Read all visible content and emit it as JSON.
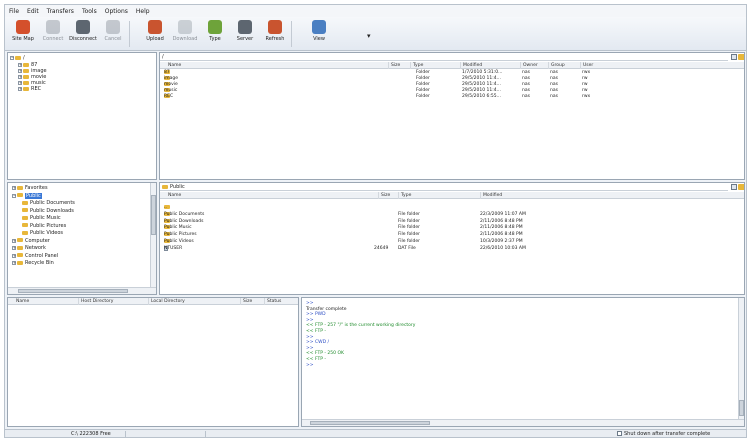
{
  "menu": [
    "File",
    "Edit",
    "Transfers",
    "Tools",
    "Options",
    "Help"
  ],
  "toolbar": [
    {
      "label": "Site Map",
      "icon": "site-map-icon",
      "color": "#d4502c",
      "enabled": true
    },
    {
      "label": "Connect",
      "icon": "connect-icon",
      "color": "#8a9199",
      "enabled": false
    },
    {
      "label": "Disconnect",
      "icon": "disconnect-icon",
      "color": "#5d6670",
      "enabled": true
    },
    {
      "label": "Cancel",
      "icon": "cancel-icon",
      "color": "#8a9199",
      "enabled": false
    },
    {
      "label": "Upload",
      "icon": "upload-icon",
      "color": "#c9542f",
      "enabled": true
    },
    {
      "label": "Download",
      "icon": "download-icon",
      "color": "#9aa1a8",
      "enabled": false
    },
    {
      "label": "Type",
      "icon": "type-icon",
      "color": "#6ea33a",
      "enabled": true
    },
    {
      "label": "Server",
      "icon": "server-icon",
      "color": "#5d6670",
      "enabled": true
    },
    {
      "label": "Refresh",
      "icon": "refresh-icon",
      "color": "#c9542f",
      "enabled": true
    },
    {
      "label": "View",
      "icon": "view-icon",
      "color": "#4a7fc2",
      "enabled": true
    }
  ],
  "remote": {
    "tree_root": "/",
    "tree": [
      "87",
      "image",
      "movie",
      "music",
      "REC"
    ],
    "path": "/",
    "columns": [
      "Name",
      "Size",
      "Type",
      "Modified",
      "Owner",
      "Group",
      "User"
    ],
    "files": [
      {
        "name": "87",
        "size": "",
        "type": "Folder",
        "modified": "1/7/2010 5:31:0...",
        "owner": "nas",
        "group": "nas",
        "user": "rwx"
      },
      {
        "name": "image",
        "size": "",
        "type": "Folder",
        "modified": "29/5/2010 11:4...",
        "owner": "nas",
        "group": "nas",
        "user": "rw"
      },
      {
        "name": "movie",
        "size": "",
        "type": "Folder",
        "modified": "29/5/2010 11:4...",
        "owner": "nas",
        "group": "nas",
        "user": "rw"
      },
      {
        "name": "music",
        "size": "",
        "type": "Folder",
        "modified": "29/5/2010 11:4...",
        "owner": "nas",
        "group": "nas",
        "user": "rw"
      },
      {
        "name": "REC",
        "size": "",
        "type": "Folder",
        "modified": "29/5/2010 6:55...",
        "owner": "nas",
        "group": "nas",
        "user": "rwx"
      }
    ]
  },
  "local": {
    "tree": [
      {
        "label": "Favorites",
        "indent": 0
      },
      {
        "label": "Public",
        "indent": 0,
        "selected": true
      },
      {
        "label": "Public Documents",
        "indent": 1
      },
      {
        "label": "Public Downloads",
        "indent": 1
      },
      {
        "label": "Public Music",
        "indent": 1
      },
      {
        "label": "Public Pictures",
        "indent": 1
      },
      {
        "label": "Public Videos",
        "indent": 1
      },
      {
        "label": "Computer",
        "indent": 0
      },
      {
        "label": "Network",
        "indent": 0
      },
      {
        "label": "Control Panel",
        "indent": 0
      },
      {
        "label": "Recycle Bin",
        "indent": 0
      }
    ],
    "path": "Public",
    "columns": [
      "Name",
      "Size",
      "Type",
      "Modified"
    ],
    "files": [
      {
        "name": "..",
        "size": "",
        "type": "",
        "modified": "",
        "kind": "folder"
      },
      {
        "name": "Public Documents",
        "size": "",
        "type": "File folder",
        "modified": "22/3/2009 11:07 AM",
        "kind": "folder"
      },
      {
        "name": "Public Downloads",
        "size": "",
        "type": "File folder",
        "modified": "2/11/2006 8:48 PM",
        "kind": "folder"
      },
      {
        "name": "Public Music",
        "size": "",
        "type": "File folder",
        "modified": "2/11/2006 8:48 PM",
        "kind": "folder"
      },
      {
        "name": "Public Pictures",
        "size": "",
        "type": "File folder",
        "modified": "2/11/2006 8:48 PM",
        "kind": "folder"
      },
      {
        "name": "Public Videos",
        "size": "",
        "type": "File folder",
        "modified": "10/3/2009 2:37 PM",
        "kind": "folder"
      },
      {
        "name": "NTUSER",
        "size": "24649",
        "type": "DAT File",
        "modified": "22/6/2010 10:03 AM",
        "kind": "file"
      }
    ]
  },
  "queue": {
    "columns": [
      "Name",
      "Host Directory",
      "Local Directory",
      "Size",
      "Status"
    ]
  },
  "log": [
    {
      "text": ">>",
      "color": "#2b4cc4"
    },
    {
      "text": "Transfer complete",
      "color": "#222222"
    },
    {
      "text": ">> PWD",
      "color": "#2b4cc4"
    },
    {
      "text": ">>",
      "color": "#2b4cc4"
    },
    {
      "text": "<< FTP - 257 \"/\" is the current working directory",
      "color": "#1d8a2a"
    },
    {
      "text": "<< FTP -",
      "color": "#1d8a2a"
    },
    {
      "text": ">>",
      "color": "#2b4cc4"
    },
    {
      "text": ">> CWD /",
      "color": "#2b4cc4"
    },
    {
      "text": ">>",
      "color": "#2b4cc4"
    },
    {
      "text": "<< FTP - 250 OK",
      "color": "#1d8a2a"
    },
    {
      "text": "<< FTP -",
      "color": "#1d8a2a"
    },
    {
      "text": ">>",
      "color": "#2b4cc4"
    }
  ],
  "status": {
    "free_space": "C:\\ 222308 Free",
    "checkbox_label": "Shut down after transfer complete"
  }
}
